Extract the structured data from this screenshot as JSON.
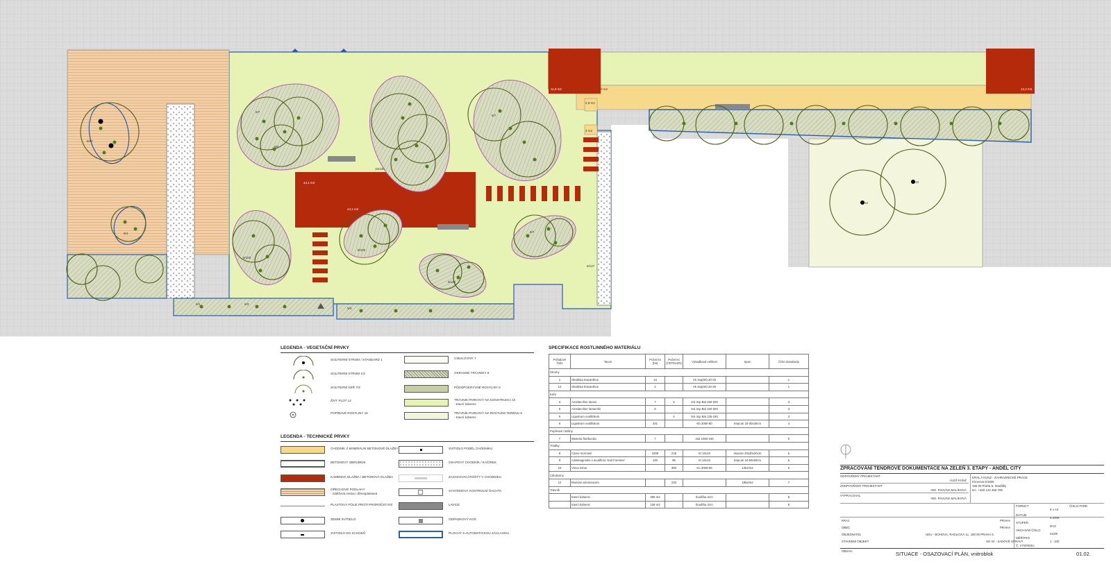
{
  "plan": {
    "area_labels": {
      "main_bed": "44,1 m2",
      "block_nw": "11,9 m2",
      "block_ne": "12,2 m2",
      "block_mid": "2,8 m2",
      "block_small": "3 m2",
      "strip": "9 m2"
    },
    "tree_labels": {
      "t1": "8/7",
      "t2": "8/87",
      "t3": "10/100",
      "t4": "8/100",
      "t5": "9/4",
      "t6": "8/7",
      "t7": "8/100",
      "t8": "8/4",
      "t9": "8/120",
      "t10": "8/7",
      "t11": "13",
      "t12": "12",
      "t13": "6/127",
      "t14": "8/2",
      "t15": "8/3",
      "t16": "9/3"
    }
  },
  "legend_veg": {
    "title": "LEGENDA - VEGETAČNÍ PRVKY",
    "items_left": [
      "SOLITERNÍ STROM / STANDARD 1",
      "SOLITERNÍ STROM 1/3",
      "SOLITERNÍ KEŘ 7/3",
      "ŽIVÝ PLOT 14",
      "POPÍNAVÉ ROSTLINY 15"
    ],
    "items_right": [
      "CIBULOVINY 7",
      "OKRASNÉ TRÁVNÍKY 8",
      "PŮDOPOKRYVNÉ ROSTLINY 8",
      "TRÁVNÍK PARKOVÝ NA KONSTRUKCI 10",
      "- travní koberec",
      "TRÁVNÍK PARKOVÝ NA ROSTLÉM TERÉNU 9",
      "- travní koberec"
    ]
  },
  "legend_tech": {
    "title": "LEGENDA - TECHNICKÉ PRVKY",
    "items_left": [
      "CHODNÍK Z MINERÁLNÍ BETONOVÉ DLAŽBY",
      "BETONOVÝ OBRUBNÍK",
      "KAMENNÁ DLAŽBA / BETONOVÁ DLAŽBA",
      "OŘECHOVÉ PODLAHY",
      "- zátěžová vrstva / dřevoplastová",
      "PLASTOVÁ FÓLIE PROTI PROROŮSTÁNÍ",
      "ZEMNÍ SVÍTIDLO",
      "SVÍTIDLO DO SCHODŮ"
    ],
    "items_right": [
      "SVÍTIDLO PODÉL CHODNÍKU",
      "OKAPOVÝ CHODNÍK / KAČÍREK",
      "ZASAKOVACÍ ROŠTY V CHODNÍKU",
      "SYSTÉMOVÁ KONTROLNÍ ŠACHTA",
      "LAVICE",
      "ODPADKOVÝ KOŠ",
      "PLOCHY S AUTOMATICKOU ZÁVLAHOU"
    ]
  },
  "spec": {
    "title": "SPECIFIKACE ROSTLINNÉHO MATERIÁLU",
    "headers": [
      "Pořadové číslo",
      "Taxon",
      "Počet ks (ha)",
      "Počet ks (ČETELEN)",
      "Výsadbová velikost",
      "Spon",
      "Číslo standardu"
    ],
    "groups": [
      {
        "name": "Stromy",
        "rows": [
          [
            "1",
            "Gleditsia triacanthos",
            "13",
            "",
            "Vk 3xp(60) 20-25",
            "",
            "1"
          ],
          [
            "13",
            "Gleditsia triacanthos",
            "2",
            "",
            "Vk 3xp(60) 20-25",
            "",
            "1"
          ]
        ]
      },
      {
        "name": "Keře",
        "rows": [
          [
            "3",
            "Amelanchier laevis",
            "7",
            "5",
            "Sol 3xp Bal 150-200",
            "",
            "3"
          ],
          [
            "5",
            "Amelanchier lamarckii",
            "5",
            "",
            "Sol 3xp Bal 150-200",
            "",
            "3"
          ],
          [
            "5",
            "Ligustrum ovalifolium",
            "",
            "4",
            "Sol 3xp Bal 125-150",
            "",
            "3"
          ],
          [
            "6",
            "Ligustrum ovalifolium",
            "431",
            "",
            "Kb 2060-80",
            "trepcan 20-30x30cm",
            "4"
          ]
        ]
      },
      {
        "name": "Popínavé rostliny",
        "rows": [
          [
            "7",
            "Wisteria floribunda",
            "7",
            "",
            "4xb 1060-100",
            "",
            "5"
          ]
        ]
      },
      {
        "name": "Trvalky",
        "rows": [
          [
            "8",
            "Carex morrowii",
            "2209",
            "218",
            "Kt 10x10",
            "trepcan 20x30x30cm",
            "6"
          ],
          [
            "9",
            "Calamagrostis x acutiflora 'Karl Foerster'",
            "130",
            "96",
            "Kt 10x10",
            "trepcan 10-50x50cm",
            "6"
          ],
          [
            "10",
            "Vinca minor",
            "",
            "350",
            "Ko 2060-65",
            "12ks/m2",
            "6"
          ]
        ]
      },
      {
        "name": "Cibuloviny",
        "rows": [
          [
            "12",
            "Muscari armeniacum",
            "",
            "220",
            "",
            "16ks/m2",
            "7"
          ]
        ]
      },
      {
        "name": "Trávník",
        "rows": [
          [
            "",
            "travní koberec",
            "395 m2",
            "",
            "tloušťka 2cm",
            "",
            "8"
          ],
          [
            "",
            "travní koberec",
            "108 m2",
            "",
            "tloušťka 2cm",
            "",
            "8"
          ]
        ]
      }
    ]
  },
  "title_block": {
    "title": "ZPRACOVÁNÍ TENDROVÉ DOKUMENTACE NA ZELEŇ 3. ETAPY - ANDĚL CITY",
    "rows_left_labels": [
      "ODPOVĚDNÝ PROJEKTANT",
      "ZODPOVĚDNÝ PROJEKTANT",
      "VYPRACOVAL"
    ],
    "rows_names": [
      "ALEŠ KUNZ",
      "ING. PAVLÍNA MALÍKOVÁ",
      "ING. PAVLÍNA MALÍKOVÁ"
    ],
    "company": [
      "ERAL A KUNZ - ZAHRADNICKÉ PRÁCE",
      "Kirovova 6/1606",
      "155 00 Praha 5, Stodůlky",
      "tel.: +420 123 456 789"
    ],
    "info_labels": [
      "KRAJ",
      "OBEC",
      "OBJEDNATEL",
      "STAVEBNÍ OBJEKT"
    ],
    "info_values": [
      "PRAHA",
      "PRAHA",
      "UDU - BOHOVA, RADLICKÁ 1c, 150 00 PRAHA 5",
      "SO 04 - SADOVÉ ÚPRAVY"
    ],
    "meta_labels": [
      "FORMÁT",
      "DATUM",
      "STUPEŇ",
      "ARCHIVNÍ ČÍSLO",
      "MĚŘÍTKO",
      "Č. VÝKRESU"
    ],
    "meta_values": [
      "6 x A4",
      "4.2006",
      "DVZ",
      "01/08",
      "1 : 100",
      ""
    ],
    "bottom_label": "OBSAH",
    "drawing_name": "SITUACE - OSAZOVACÍ PLÁN, vnitroblok",
    "drawing_number": "01.02.",
    "stamp_label": "ČÍSLO PARÉ"
  }
}
